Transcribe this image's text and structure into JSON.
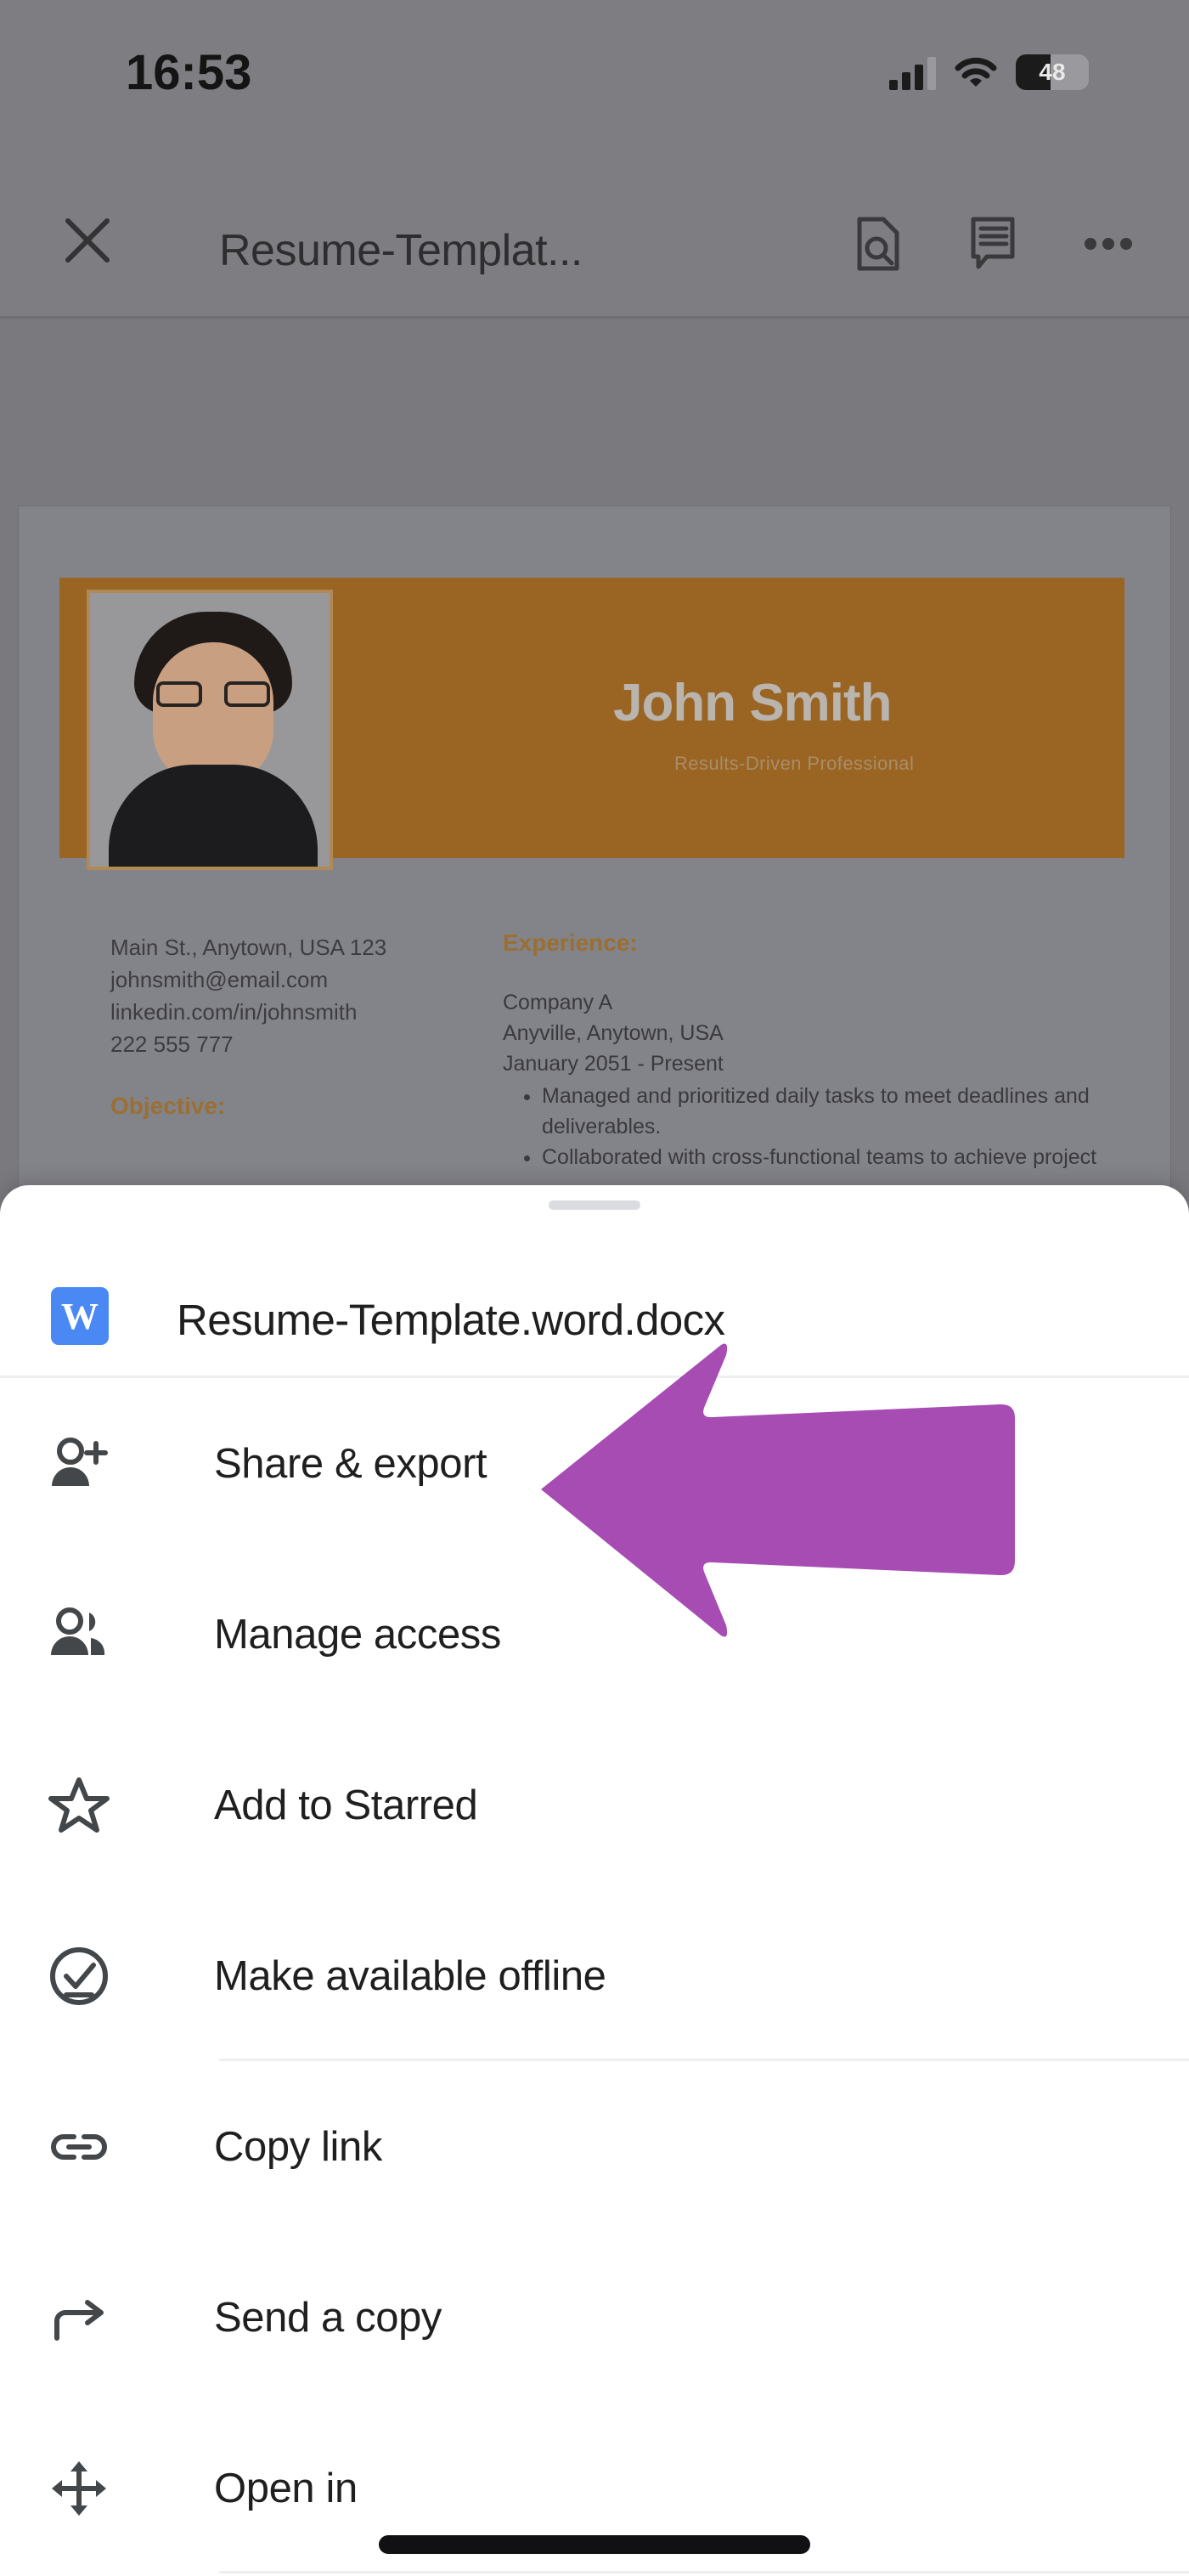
{
  "status_bar": {
    "time": "16:53",
    "battery_level": "48",
    "battery_percent": 48,
    "signal_bars_filled": 3,
    "signal_bars_total": 4,
    "icons": [
      "signal-icon",
      "wifi-icon",
      "battery-icon"
    ]
  },
  "app_bar": {
    "close_label": "close-icon",
    "title": "Resume-Templat...",
    "actions": [
      {
        "name": "document-search-icon",
        "label": "Find"
      },
      {
        "name": "comments-icon",
        "label": "Comments"
      },
      {
        "name": "overflow-menu-icon",
        "label": "More options"
      }
    ]
  },
  "document": {
    "name": "John Smith",
    "subtitle": "Results-Driven Professional",
    "banner_color": "#9a6422",
    "accent_color": "#9a6f33",
    "contact": [
      "Main St., Anytown, USA 123",
      "johnsmith@email.com",
      "linkedin.com/in/johnsmith",
      "222 555 777"
    ],
    "objective_heading": "Objective:",
    "experience_heading": "Experience:",
    "experience": {
      "company": "Company A",
      "location": "Anyville, Anytown, USA",
      "dates": "January 2051 - Present",
      "bullets": [
        "Managed and prioritized daily tasks to meet deadlines and deliverables.",
        "Collaborated with cross-functional teams to achieve project"
      ]
    }
  },
  "sheet": {
    "file_icon": "word-file-icon",
    "file_icon_letter": "W",
    "file_icon_color": "#4a89f3",
    "file_name": "Resume-Template.word.docx",
    "menu_items": [
      {
        "icon": "person-add-icon",
        "label": "Share & export",
        "separator_after": false
      },
      {
        "icon": "people-icon",
        "label": "Manage access",
        "separator_after": false
      },
      {
        "icon": "star-outline-icon",
        "label": "Add to Starred",
        "separator_after": false
      },
      {
        "icon": "check-circle-icon",
        "label": "Make available offline",
        "separator_after": true
      },
      {
        "icon": "link-icon",
        "label": "Copy link",
        "separator_after": false
      },
      {
        "icon": "send-arrow-icon",
        "label": "Send a copy",
        "separator_after": false
      },
      {
        "icon": "open-in-move-icon",
        "label": "Open in",
        "separator_after": true
      }
    ]
  },
  "annotation": {
    "type": "arrow-pointing-left",
    "color": "#a64cb3",
    "points_at": "Share & export"
  }
}
